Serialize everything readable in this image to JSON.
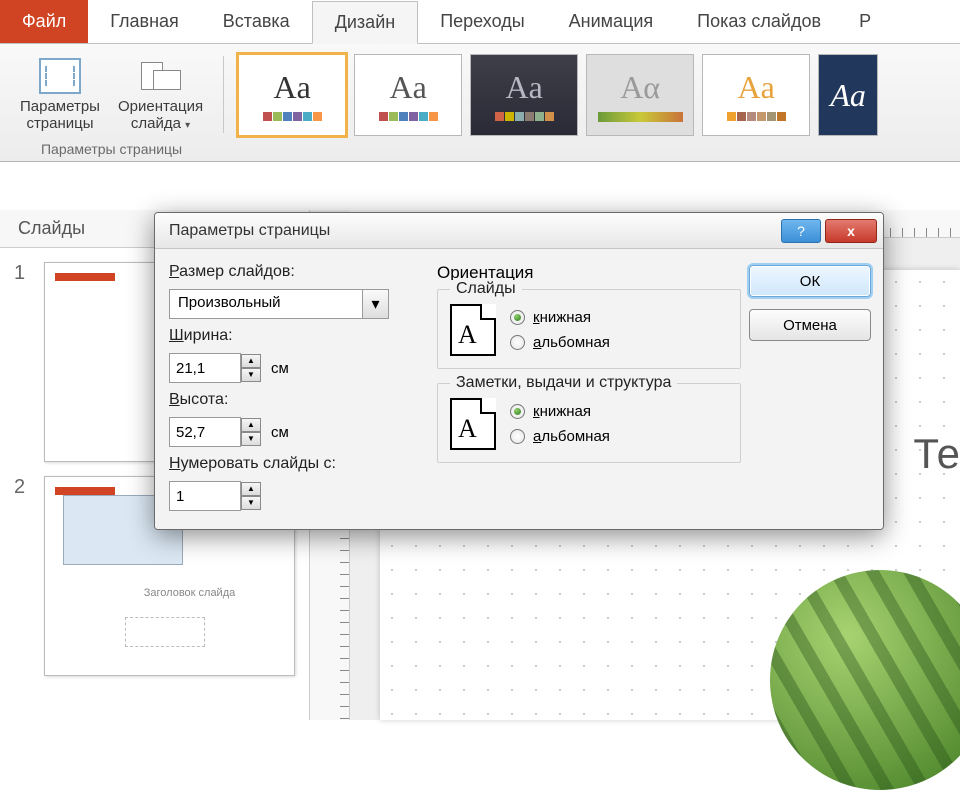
{
  "tabs": {
    "file": "Файл",
    "home": "Главная",
    "insert": "Вставка",
    "design": "Дизайн",
    "transitions": "Переходы",
    "animation": "Анимация",
    "slideshow": "Показ слайдов",
    "trunc": "Р"
  },
  "ribbon": {
    "page_setup_l1": "Параметры",
    "page_setup_l2": "страницы",
    "orient_l1": "Ориентация",
    "orient_l2": "слайда",
    "dropdown_caret": "▾",
    "group_title": "Параметры страницы",
    "theme_aa": "Aa",
    "theme_aa_alt": "Aα",
    "swatch_colors": [
      "#c0504d",
      "#9bbb59",
      "#4f81bd",
      "#f79646",
      "#2c4d75",
      "#5f497a",
      "#4bacc6",
      "#7f7f7f"
    ]
  },
  "slides_pane": {
    "tab": "Слайды",
    "n1": "1",
    "n2": "2",
    "thumb2_caption": "Заголовок слайда"
  },
  "canvas": {
    "text": "Те"
  },
  "dialog": {
    "title": "Параметры страницы",
    "help": "?",
    "close": "x",
    "size_label": "Размер слайдов:",
    "size_value": "Произвольный",
    "width_label_pre": "",
    "width_label": "Ширина:",
    "width_u": "Ш",
    "width_value": "21,1",
    "height_label": "ысота:",
    "height_u": "В",
    "height_value": "52,7",
    "unit": "см",
    "number_label_pre": "",
    "number_label": "умеровать слайды с:",
    "number_u": "Н",
    "number_value": "1",
    "orientation_title": "Ориентация",
    "slides_legend": "Слайды",
    "notes_legend": "Заметки, выдачи и структура",
    "portrait_pre": "",
    "portrait_u": "к",
    "portrait_rest": "нижная",
    "landscape_pre": "",
    "landscape_u": "а",
    "landscape_rest": "льбомная",
    "ok": "ОК",
    "cancel": "Отмена",
    "doc_A": "A",
    "caret": "▾",
    "up": "▲",
    "down": "▼"
  }
}
